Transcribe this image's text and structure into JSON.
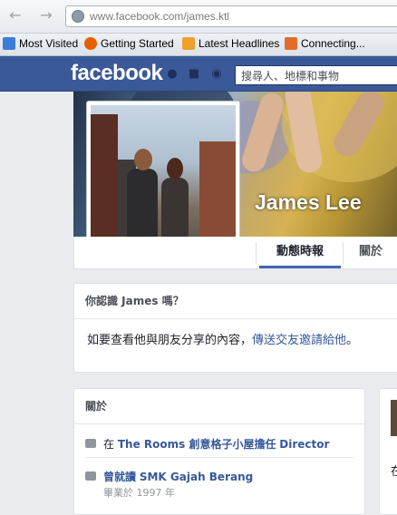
{
  "browser": {
    "url_prefix": "www.facebook.com",
    "url_path": "/james.ktl",
    "back_icon": "back-arrow-icon",
    "forward_icon": "forward-arrow-icon",
    "bookmarks": [
      {
        "label": "Most Visited",
        "icon": "most-visited-icon",
        "color": "#3b7dd8"
      },
      {
        "label": "Getting Started",
        "icon": "firefox-icon",
        "color": "#e66000"
      },
      {
        "label": "Latest Headlines",
        "icon": "rss-icon",
        "color": "#f0a12b"
      },
      {
        "label": "Connecting...",
        "icon": "mail-icon",
        "color": "#e36c2c"
      }
    ]
  },
  "facebook": {
    "logo": "facebook",
    "brand_color": "#3b5998",
    "search_placeholder": "搜尋人、地標和事物"
  },
  "profile": {
    "name": "James Lee",
    "tabs": [
      {
        "label": "動態時報",
        "active": true
      },
      {
        "label": "關於",
        "active": false
      }
    ]
  },
  "know_card": {
    "title": "你認識 James 嗎？",
    "text_before": "如要查看他與朋友分享的內容，",
    "link_text": "傳送交友邀請給他",
    "text_after": "。"
  },
  "about_card": {
    "title": "關於",
    "work": {
      "prefix": "在",
      "place": "The Rooms 創意格子小屋擔任",
      "role": "Director"
    },
    "education": {
      "prefix": "曾就讀",
      "school": "SMK Gajah Berang",
      "sub": "畢業於 1997 年"
    }
  },
  "right_column_fragment": "在"
}
